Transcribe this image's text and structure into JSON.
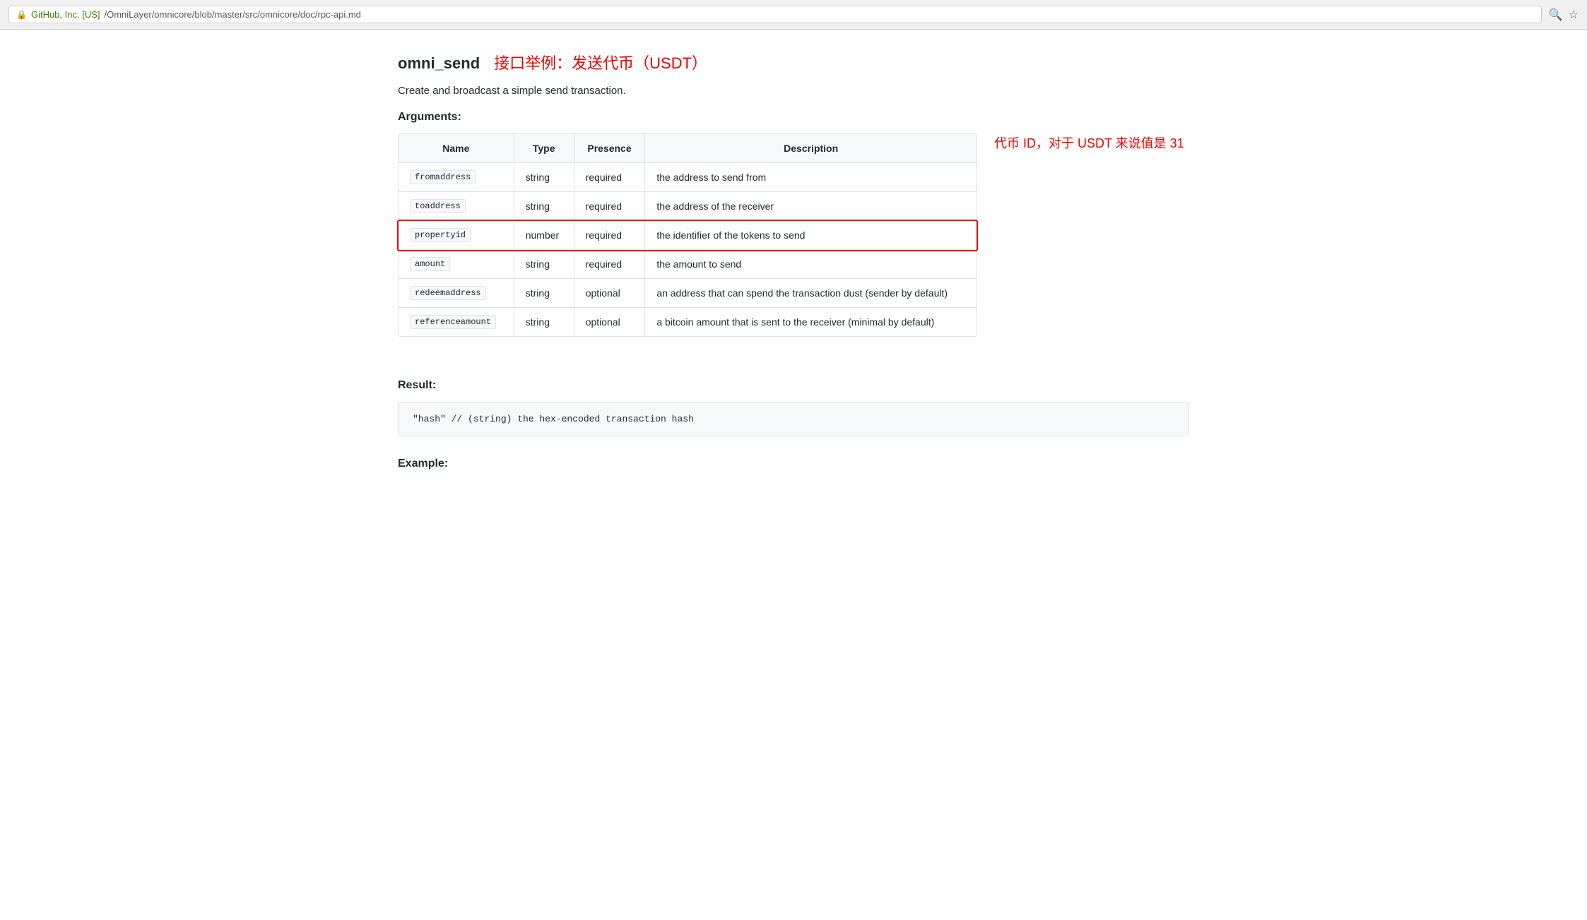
{
  "browser": {
    "secure_label": "GitHub, Inc. [US]",
    "url_full": "https://github.com/OmniLayer/omnicore/blob/master/src/omnicore/doc/rpc-api.md",
    "url_origin": "https://github.com",
    "url_path": "/OmniLayer/omnicore/blob/master/src/omnicore/doc/rpc-api.md"
  },
  "page": {
    "title_main": "omni_send",
    "title_sub": "接口举例：发送代币（USDT）",
    "description": "Create and broadcast a simple send transaction.",
    "arguments_heading": "Arguments:",
    "result_heading": "Result:",
    "example_heading": "Example:"
  },
  "table": {
    "headers": [
      "Name",
      "Type",
      "Presence",
      "Description"
    ],
    "rows": [
      {
        "name": "fromaddress",
        "type": "string",
        "presence": "required",
        "description": "the address to send from",
        "highlighted": false
      },
      {
        "name": "toaddress",
        "type": "string",
        "presence": "required",
        "description": "the address of the receiver",
        "highlighted": false
      },
      {
        "name": "propertyid",
        "type": "number",
        "presence": "required",
        "description": "the identifier of the tokens to send",
        "highlighted": true
      },
      {
        "name": "amount",
        "type": "string",
        "presence": "required",
        "description": "the amount to send",
        "highlighted": false
      },
      {
        "name": "redeemaddress",
        "type": "string",
        "presence": "optional",
        "description": "an address that can spend the transaction dust (sender by default)",
        "highlighted": false
      },
      {
        "name": "referenceamount",
        "type": "string",
        "presence": "optional",
        "description": "a bitcoin amount that is sent to the receiver (minimal by default)",
        "highlighted": false
      }
    ]
  },
  "annotation": {
    "text": "代币 ID，对于 USDT 来说值是 31"
  },
  "code_result": "\"hash\"  // (string) the hex-encoded transaction hash"
}
